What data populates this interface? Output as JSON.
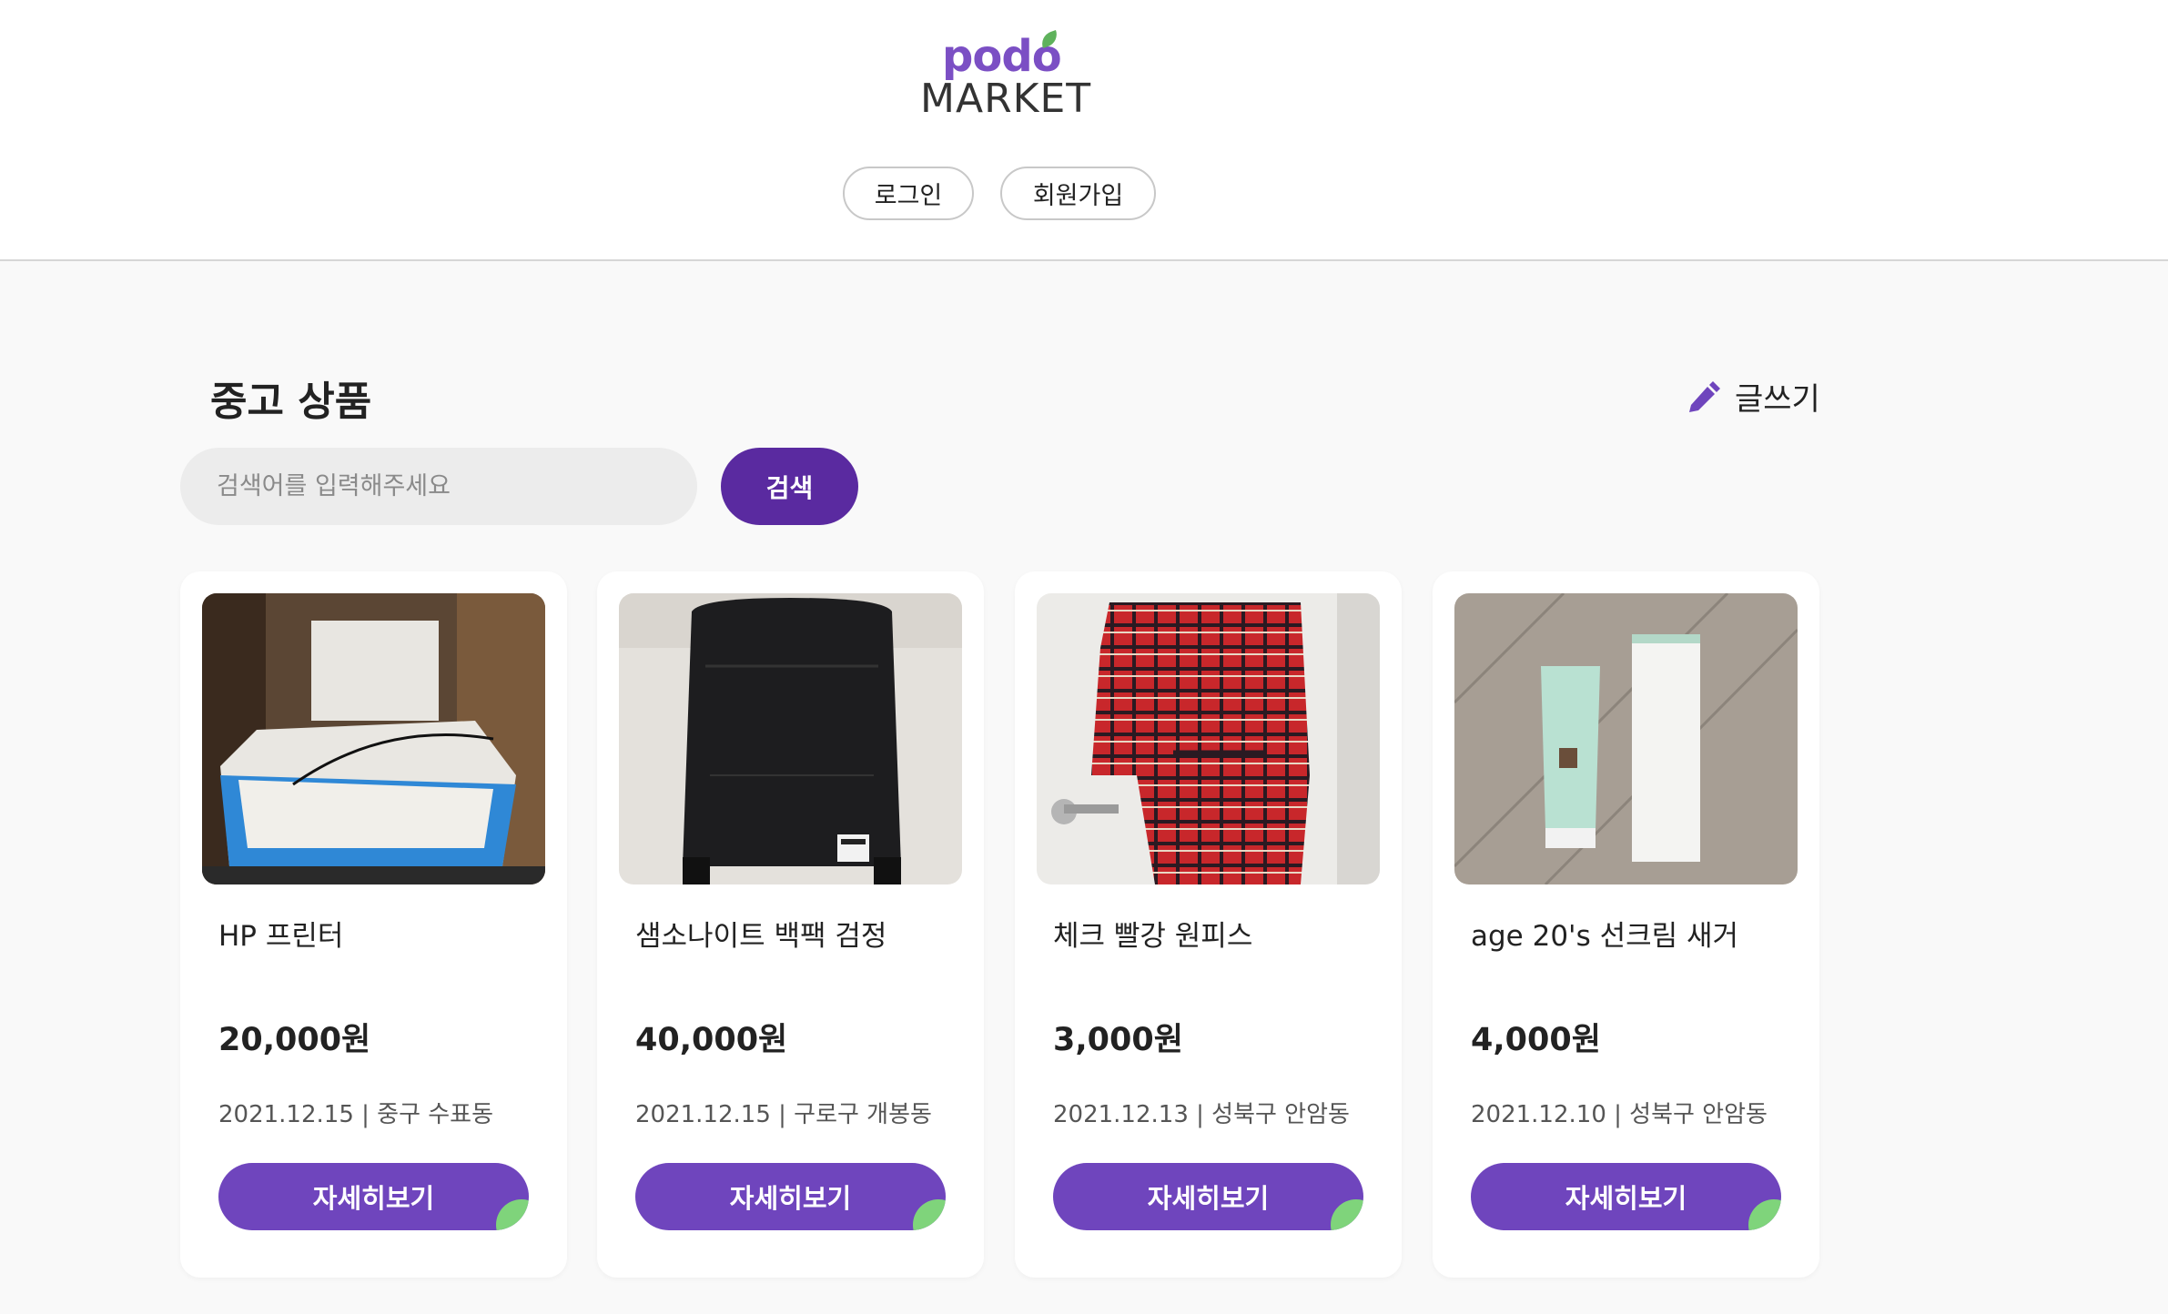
{
  "header": {
    "logo_top": "podo",
    "logo_bottom": "MARKET",
    "login_label": "로그인",
    "signup_label": "회원가입"
  },
  "main": {
    "section_title": "중고 상품",
    "write_label": "글쓰기",
    "search": {
      "placeholder": "검색어를 입력해주세요",
      "value": "",
      "button_label": "검색"
    },
    "products": [
      {
        "title": "HP 프린터",
        "price": "20,000원",
        "meta": "2021.12.15 | 중구 수표동",
        "button_label": "자세히보기",
        "image": "printer"
      },
      {
        "title": "샘소나이트 백팩 검정",
        "price": "40,000원",
        "meta": "2021.12.15 | 구로구 개봉동",
        "button_label": "자세히보기",
        "image": "backpack"
      },
      {
        "title": "체크 빨강 원피스",
        "price": "3,000원",
        "meta": "2021.12.13 | 성북구 안암동",
        "button_label": "자세히보기",
        "image": "dress"
      },
      {
        "title": "age 20's 선크림 새거",
        "price": "4,000원",
        "meta": "2021.12.10 | 성북구 안암동",
        "button_label": "자세히보기",
        "image": "suncream"
      }
    ]
  },
  "colors": {
    "brand_purple": "#6f45bd",
    "search_button": "#5a2aa0",
    "accent_green": "#7fd47b"
  }
}
